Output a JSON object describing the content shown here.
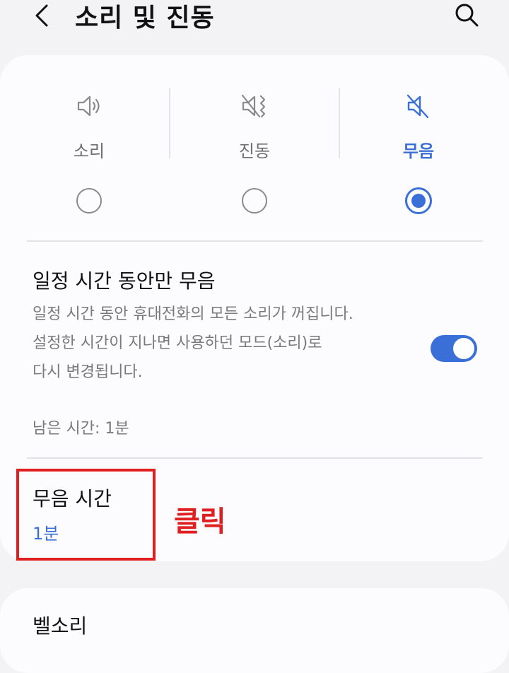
{
  "header": {
    "title": "소리 및 진동",
    "back_icon": "back-arrow-icon",
    "search_icon": "search-icon"
  },
  "modes": [
    {
      "label": "소리",
      "icon": "speaker-icon",
      "selected": false
    },
    {
      "label": "진동",
      "icon": "vibrate-icon",
      "selected": false
    },
    {
      "label": "무음",
      "icon": "mute-icon",
      "selected": true
    }
  ],
  "timed_mute": {
    "title": "일정 시간 동안만 무음",
    "description": [
      "일정 시간 동안 휴대전화의 모든 소리가 꺼집니다.",
      "설정한 시간이 지나면 사용하던 모드(소리)로",
      "다시 변경됩니다."
    ],
    "enabled": true,
    "remaining": "남은 시간: 1분"
  },
  "mute_time": {
    "title": "무음 시간",
    "value": "1분"
  },
  "ringtone": {
    "title": "벨소리"
  },
  "annotation": {
    "label": "클릭"
  },
  "colors": {
    "accent": "#3a6fd8",
    "annotation": "#e02020",
    "background": "#f3f3f6",
    "card": "#fcfcfe"
  }
}
